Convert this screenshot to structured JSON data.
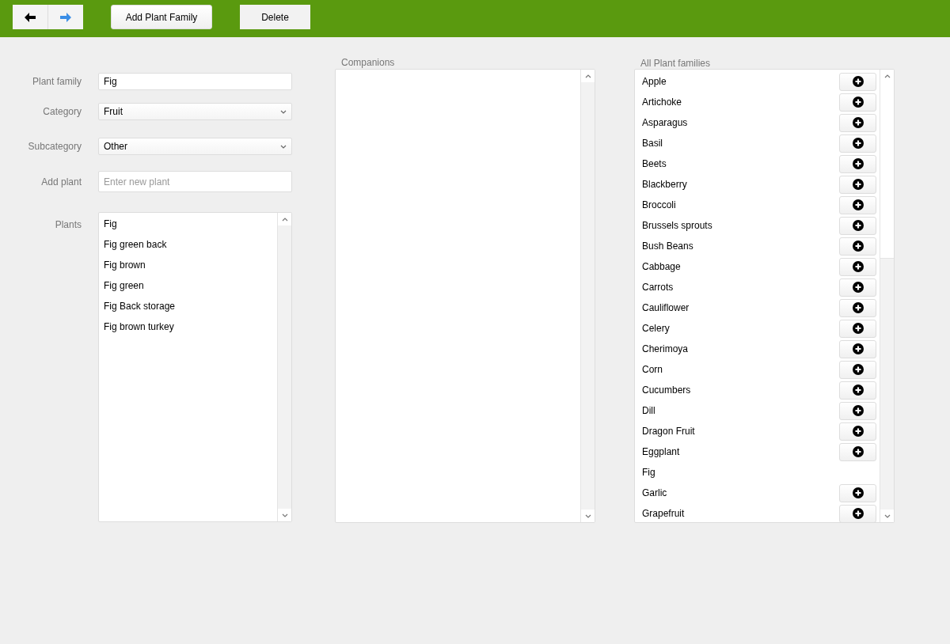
{
  "toolbar": {
    "buttons": [
      {
        "kind": "back"
      },
      {
        "kind": "forward"
      },
      {
        "kind": "text",
        "label": "Add Plant Family"
      },
      {
        "kind": "text",
        "label": "Delete"
      }
    ]
  },
  "form": {
    "fields": [
      {
        "kind": "text",
        "label": "Plant family",
        "value": "Fig"
      },
      {
        "kind": "select",
        "label": "Category",
        "value": "Fruit"
      },
      {
        "kind": "select",
        "label": "Subcategory",
        "value": "Other"
      },
      {
        "kind": "input",
        "label": "Add plant",
        "placeholder": "Enter new plant"
      }
    ],
    "plants": {
      "label": "Plants",
      "items": [
        "Fig",
        "Fig green back",
        "Fig brown",
        "Fig green",
        "Fig Back storage",
        "Fig brown turkey"
      ]
    }
  },
  "companions": {
    "title": "Companions"
  },
  "all_families": {
    "title": "All Plant families",
    "items": [
      {
        "name": "Apple",
        "addable": true
      },
      {
        "name": "Artichoke",
        "addable": true
      },
      {
        "name": "Asparagus",
        "addable": true
      },
      {
        "name": "Basil",
        "addable": true
      },
      {
        "name": "Beets",
        "addable": true
      },
      {
        "name": "Blackberry",
        "addable": true
      },
      {
        "name": "Broccoli",
        "addable": true
      },
      {
        "name": "Brussels sprouts",
        "addable": true
      },
      {
        "name": "Bush Beans",
        "addable": true
      },
      {
        "name": "Cabbage",
        "addable": true
      },
      {
        "name": "Carrots",
        "addable": true
      },
      {
        "name": "Cauliflower",
        "addable": true
      },
      {
        "name": "Celery",
        "addable": true
      },
      {
        "name": "Cherimoya",
        "addable": true
      },
      {
        "name": "Corn",
        "addable": true
      },
      {
        "name": "Cucumbers",
        "addable": true
      },
      {
        "name": "Dill",
        "addable": true
      },
      {
        "name": "Dragon Fruit",
        "addable": true
      },
      {
        "name": "Eggplant",
        "addable": true
      },
      {
        "name": "Fig",
        "addable": false
      },
      {
        "name": "Garlic",
        "addable": true
      },
      {
        "name": "Grapefruit",
        "addable": true
      }
    ]
  }
}
